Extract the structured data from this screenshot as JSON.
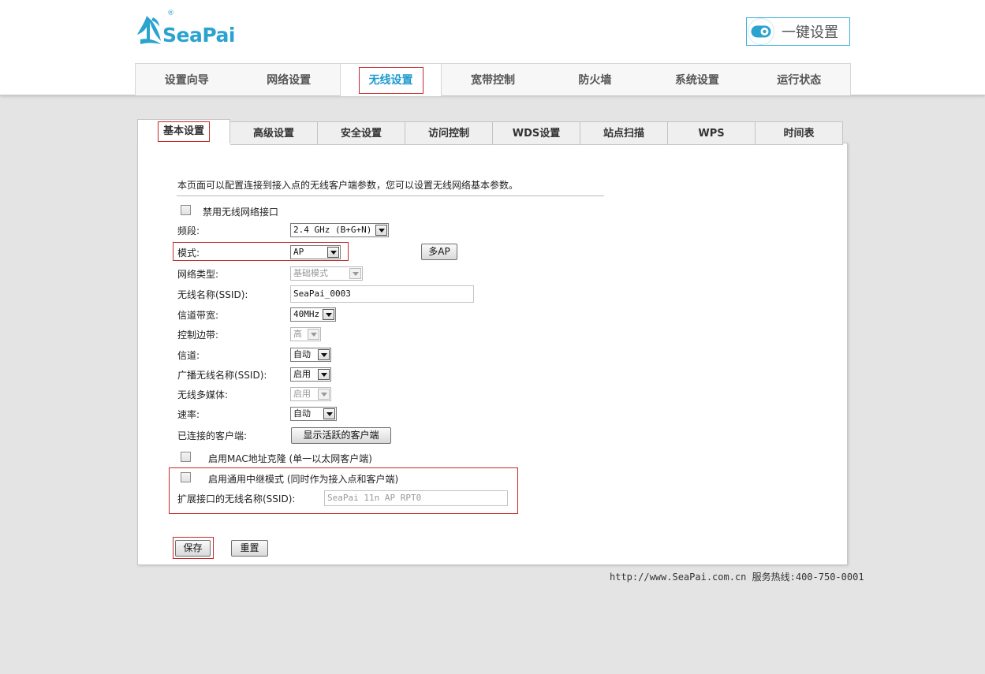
{
  "brand": {
    "name": "SeaPai",
    "registered_mark": "®"
  },
  "onekey": {
    "label": "一键设置",
    "icon": "toggle-icon",
    "accent": "#2aa3cf"
  },
  "nav": {
    "items": [
      {
        "label": "设置向导"
      },
      {
        "label": "网络设置"
      },
      {
        "label": "无线设置",
        "active": true
      },
      {
        "label": "宽带控制"
      },
      {
        "label": "防火墙"
      },
      {
        "label": "系统设置"
      },
      {
        "label": "运行状态"
      }
    ]
  },
  "subtabs": {
    "items": [
      {
        "label": "基本设置",
        "active": true
      },
      {
        "label": "高级设置"
      },
      {
        "label": "安全设置"
      },
      {
        "label": "访问控制"
      },
      {
        "label": "WDS设置"
      },
      {
        "label": "站点扫描"
      },
      {
        "label": "WPS"
      },
      {
        "label": "时间表"
      }
    ]
  },
  "form": {
    "description": "本页面可以配置连接到接入点的无线客户端参数，您可以设置无线网络基本参数。",
    "disable_wireless": {
      "label": "禁用无线网络接口",
      "checked": false
    },
    "band": {
      "label": "频段:",
      "value": "2.4 GHz (B+G+N)"
    },
    "mode": {
      "label": "模式:",
      "value": "AP",
      "multi_ap_button": "多AP"
    },
    "network_type": {
      "label": "网络类型:",
      "value": "基础模式"
    },
    "ssid": {
      "label": "无线名称(SSID):",
      "value": "SeaPai_0003"
    },
    "channel_width": {
      "label": "信道带宽:",
      "value": "40MHz"
    },
    "sideband": {
      "label": "控制边带:",
      "value": "高"
    },
    "channel": {
      "label": "信道:",
      "value": "自动"
    },
    "broadcast_ssid": {
      "label": "广播无线名称(SSID):",
      "value": "启用"
    },
    "wmm": {
      "label": "无线多媒体:",
      "value": "启用"
    },
    "rate": {
      "label": "速率:",
      "value": "自动"
    },
    "clients": {
      "label": "已连接的客户端:",
      "button": "显示活跃的客户端"
    },
    "mac_clone": {
      "label": "启用MAC地址克隆 (单一以太网客户端)",
      "checked": false
    },
    "repeater": {
      "label": "启用通用中继模式 (同时作为接入点和客户端)",
      "checked": false
    },
    "ext_ssid": {
      "label": "扩展接口的无线名称(SSID):",
      "value": "SeaPai 11n AP RPT0"
    },
    "save_button": "保存",
    "reset_button": "重置"
  },
  "footer": {
    "url": "http://www.SeaPai.com.cn",
    "hotline": "服务热线:400-750-0001"
  },
  "colors": {
    "accent": "#1f9bd0",
    "highlight": "#c62828",
    "background": "#e4e4e4"
  }
}
